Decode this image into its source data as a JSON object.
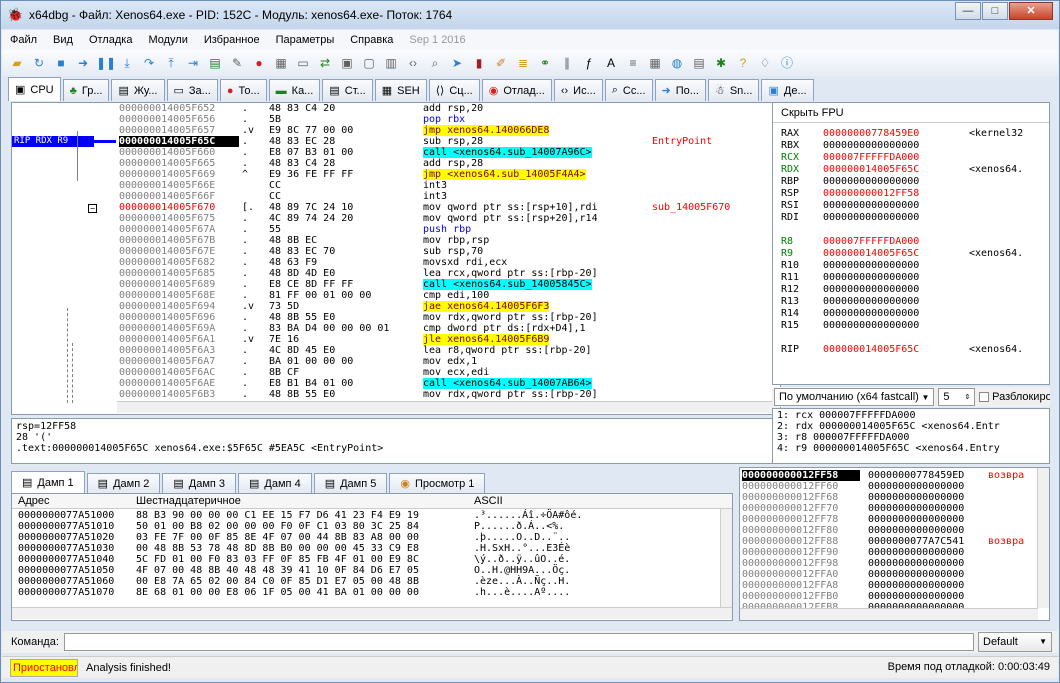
{
  "window": {
    "title": "x64dbg - Файл: Xenos64.exe - PID: 152C - Модуль: xenos64.exe- Поток: 1764",
    "app_icon": "bug-icon"
  },
  "menu": {
    "items": [
      "Файл",
      "Вид",
      "Отладка",
      "Модули",
      "Избранное",
      "Параметры",
      "Справка"
    ],
    "date": "Sep 1 2016"
  },
  "tabs": [
    {
      "label": "CPU",
      "icon": "cpu-icon"
    },
    {
      "label": "Гр...",
      "icon": "graph-icon"
    },
    {
      "label": "Жу...",
      "icon": "log-icon"
    },
    {
      "label": "За...",
      "icon": "notes-icon"
    },
    {
      "label": "То...",
      "icon": "breakpoint-icon"
    },
    {
      "label": "Ка...",
      "icon": "memory-icon"
    },
    {
      "label": "Ст...",
      "icon": "stack-icon"
    },
    {
      "label": "SEH",
      "icon": "seh-icon"
    },
    {
      "label": "Сц...",
      "icon": "script-icon"
    },
    {
      "label": "Отлад...",
      "icon": "symbols-icon"
    },
    {
      "label": "Ис...",
      "icon": "source-icon"
    },
    {
      "label": "Сс...",
      "icon": "references-icon"
    },
    {
      "label": "По...",
      "icon": "threads-icon"
    },
    {
      "label": "Sn...",
      "icon": "snowman-icon"
    },
    {
      "label": "Де...",
      "icon": "handles-icon"
    }
  ],
  "disasm": {
    "rip_label": "RIP RDX R9",
    "rows": [
      {
        "addr": "000000014005F652",
        "mark": ".",
        "bytes": "48 83 C4 20",
        "ins": "add rsp,20",
        "cmt": "",
        "type": "plain"
      },
      {
        "addr": "000000014005F656",
        "mark": ".",
        "bytes": "5B",
        "ins": "pop rbx",
        "cmt": "",
        "type": "push"
      },
      {
        "addr": "000000014005F657",
        "mark": ".v",
        "bytes": "E9 8C 77 00 00",
        "ins": "jmp xenos64.140066DE8",
        "cmt": "",
        "type": "jmp"
      },
      {
        "addr": "000000014005F65C",
        "mark": ".",
        "bytes": "48 83 EC 28",
        "ins": "sub rsp,28",
        "cmt": "EntryPoint",
        "type": "plain",
        "current": true
      },
      {
        "addr": "000000014005F660",
        "mark": ".",
        "bytes": "E8 07 B3 01 00",
        "ins": "call <xenos64.sub_14007A96C>",
        "cmt": "",
        "type": "call"
      },
      {
        "addr": "000000014005F665",
        "mark": ".",
        "bytes": "48 83 C4 28",
        "ins": "add rsp,28",
        "cmt": "",
        "type": "plain"
      },
      {
        "addr": "000000014005F669",
        "mark": "^",
        "bytes": "E9 36 FE FF FF",
        "ins": "jmp <xenos64.sub_14005F4A4>",
        "cmt": "",
        "type": "jmp"
      },
      {
        "addr": "000000014005F66E",
        "mark": "",
        "bytes": "CC",
        "ins": "int3",
        "cmt": "",
        "type": "plain"
      },
      {
        "addr": "000000014005F66F",
        "mark": "",
        "bytes": "CC",
        "ins": "int3",
        "cmt": "",
        "type": "plain"
      },
      {
        "addr": "000000014005F670",
        "mark": "[.",
        "bytes": "48 89 7C 24 10",
        "ins": "mov qword ptr ss:[rsp+10],rdi",
        "cmt": "sub_14005F670",
        "type": "plain",
        "red": true
      },
      {
        "addr": "000000014005F675",
        "mark": ".",
        "bytes": "4C 89 74 24 20",
        "ins": "mov qword ptr ss:[rsp+20],r14",
        "cmt": "",
        "type": "plain"
      },
      {
        "addr": "000000014005F67A",
        "mark": ".",
        "bytes": "55",
        "ins": "push rbp",
        "cmt": "",
        "type": "push"
      },
      {
        "addr": "000000014005F67B",
        "mark": ".",
        "bytes": "48 8B EC",
        "ins": "mov rbp,rsp",
        "cmt": "",
        "type": "plain"
      },
      {
        "addr": "000000014005F67E",
        "mark": ".",
        "bytes": "48 83 EC 70",
        "ins": "sub rsp,70",
        "cmt": "",
        "type": "plain"
      },
      {
        "addr": "000000014005F682",
        "mark": ".",
        "bytes": "48 63 F9",
        "ins": "movsxd rdi,ecx",
        "cmt": "",
        "type": "plain"
      },
      {
        "addr": "000000014005F685",
        "mark": ".",
        "bytes": "48 8D 4D E0",
        "ins": "lea rcx,qword ptr ss:[rbp-20]",
        "cmt": "",
        "type": "plain"
      },
      {
        "addr": "000000014005F689",
        "mark": ".",
        "bytes": "E8 CE 8D FF FF",
        "ins": "call <xenos64.sub_14005845C>",
        "cmt": "",
        "type": "call"
      },
      {
        "addr": "000000014005F68E",
        "mark": ".",
        "bytes": "81 FF 00 01 00 00",
        "ins": "cmp edi,100",
        "cmt": "",
        "type": "plain"
      },
      {
        "addr": "000000014005F694",
        "mark": ".v",
        "bytes": "73 5D",
        "ins": "jae xenos64.14005F6F3",
        "cmt": "",
        "type": "jmp"
      },
      {
        "addr": "000000014005F696",
        "mark": ".",
        "bytes": "48 8B 55 E0",
        "ins": "mov rdx,qword ptr ss:[rbp-20]",
        "cmt": "",
        "type": "plain"
      },
      {
        "addr": "000000014005F69A",
        "mark": ".",
        "bytes": "83 BA D4 00 00 00 01",
        "ins": "cmp dword ptr ds:[rdx+D4],1",
        "cmt": "",
        "type": "plain"
      },
      {
        "addr": "000000014005F6A1",
        "mark": ".v",
        "bytes": "7E 16",
        "ins": "jle xenos64.14005F6B9",
        "cmt": "",
        "type": "jmp"
      },
      {
        "addr": "000000014005F6A3",
        "mark": ".",
        "bytes": "4C 8D 45 E0",
        "ins": "lea r8,qword ptr ss:[rbp-20]",
        "cmt": "",
        "type": "plain"
      },
      {
        "addr": "000000014005F6A7",
        "mark": ".",
        "bytes": "BA 01 00 00 00",
        "ins": "mov edx,1",
        "cmt": "",
        "type": "plain"
      },
      {
        "addr": "000000014005F6AC",
        "mark": ".",
        "bytes": "8B CF",
        "ins": "mov ecx,edi",
        "cmt": "",
        "type": "plain"
      },
      {
        "addr": "000000014005F6AE",
        "mark": ".",
        "bytes": "E8 B1 B4 01 00",
        "ins": "call <xenos64.sub_14007AB64>",
        "cmt": "",
        "type": "call"
      },
      {
        "addr": "000000014005F6B3",
        "mark": ".",
        "bytes": "48 8B 55 E0",
        "ins": "mov rdx,qword ptr ss:[rbp-20]",
        "cmt": "",
        "type": "plain"
      }
    ]
  },
  "info": {
    "lines": [
      "rsp=12FF58",
      "28 '('",
      ".text:000000014005F65C xenos64.exe:$5F65C #5EA5C <EntryPoint>"
    ]
  },
  "registers": {
    "header": "Скрыть FPU",
    "rows": [
      {
        "name": "RAX",
        "value": "00000000778459E0",
        "cmt": "<kernel32",
        "changed": false,
        "red": true
      },
      {
        "name": "RBX",
        "value": "0000000000000000",
        "cmt": "",
        "changed": false
      },
      {
        "name": "RCX",
        "value": "000007FFFFFDA000",
        "cmt": "",
        "changed": true
      },
      {
        "name": "RDX",
        "value": "000000014005F65C",
        "cmt": "<xenos64.",
        "changed": true
      },
      {
        "name": "RBP",
        "value": "0000000000000000",
        "cmt": "",
        "changed": false
      },
      {
        "name": "RSP",
        "value": "000000000012FF58",
        "cmt": "",
        "changed": false,
        "red": true
      },
      {
        "name": "RSI",
        "value": "0000000000000000",
        "cmt": "",
        "changed": false
      },
      {
        "name": "RDI",
        "value": "0000000000000000",
        "cmt": "",
        "changed": false
      },
      {
        "name": "",
        "value": "",
        "cmt": "",
        "changed": false
      },
      {
        "name": "R8",
        "value": "000007FFFFFDA000",
        "cmt": "",
        "changed": true
      },
      {
        "name": "R9",
        "value": "000000014005F65C",
        "cmt": "<xenos64.",
        "changed": true
      },
      {
        "name": "R10",
        "value": "0000000000000000",
        "cmt": "",
        "changed": false
      },
      {
        "name": "R11",
        "value": "0000000000000000",
        "cmt": "",
        "changed": false
      },
      {
        "name": "R12",
        "value": "0000000000000000",
        "cmt": "",
        "changed": false
      },
      {
        "name": "R13",
        "value": "0000000000000000",
        "cmt": "",
        "changed": false
      },
      {
        "name": "R14",
        "value": "0000000000000000",
        "cmt": "",
        "changed": false
      },
      {
        "name": "R15",
        "value": "0000000000000000",
        "cmt": "",
        "changed": false
      },
      {
        "name": "",
        "value": "",
        "cmt": "",
        "changed": false
      },
      {
        "name": "RIP",
        "value": "000000014005F65C",
        "cmt": "<xenos64.",
        "changed": false,
        "red": true
      }
    ]
  },
  "callconv": {
    "selected": "По умолчанию (x64 fastcall)",
    "count": "5",
    "unlock_label": "Разблокировать"
  },
  "args": [
    "1: rcx 000007FFFFFDA000",
    "2: rdx 000000014005F65C <xenos64.Entr",
    "3: r8 000007FFFFFDA000",
    "4: r9 000000014005F65C <xenos64.Entry"
  ],
  "dump_tabs": [
    "Дамп 1",
    "Дамп 2",
    "Дамп 3",
    "Дамп 4",
    "Дамп 5",
    "Просмотр 1"
  ],
  "dump": {
    "col_addr": "Адрес",
    "col_hex": "Шестнадцатеричное",
    "col_ascii": "ASCII",
    "rows": [
      {
        "addr": "0000000077A51000",
        "hex": "88 B3 90 00 00 00 C1 EE 15 F7 D6 41 23 F4 E9 19",
        "ascii": ".³......Áî.÷ÖA#ôé."
      },
      {
        "addr": "0000000077A51010",
        "hex": "50 01 00 B8 02 00 00 00 F0 0F C1 03 80 3C 25 84",
        "ascii": "P......ð.Á..<%."
      },
      {
        "addr": "0000000077A51020",
        "hex": "03 FE 7F 00 0F 85 8E 4F 07 00 44 8B 83 A8 00 00",
        "ascii": ".þ.....O..D..¨.."
      },
      {
        "addr": "0000000077A51030",
        "hex": "00 48 8B 53 78 48 8D 8B B0 00 00 00 45 33 C9 E8",
        "ascii": ".H.SxH..°...E3Éè"
      },
      {
        "addr": "0000000077A51040",
        "hex": "5C FD 01 00 F0 83 03 FF 0F 85 FB 4F 01 00 E9 8C",
        "ascii": "\\ý..ð..ÿ..ûO..é."
      },
      {
        "addr": "0000000077A51050",
        "hex": "4F 07 00 48 8B 40 48 48 39 41 10 0F 84 D6 E7 05",
        "ascii": "O..H.@HH9A...Öç."
      },
      {
        "addr": "0000000077A51060",
        "hex": "00 E8 7A 65 02 00 84 C0 0F 85 D1 E7 05 00 48 8B",
        "ascii": ".èze...À..Ñç..H."
      },
      {
        "addr": "0000000077A51070",
        "hex": "8E 68 01 00 00 E8 06 1F 05 00 41 BA 01 00 00 00",
        "ascii": ".h...è....Aº...."
      }
    ]
  },
  "stack": {
    "rows": [
      {
        "addr": "000000000012FF58",
        "val": "00000000778459ED",
        "cmt": "возвра",
        "current": true
      },
      {
        "addr": "000000000012FF60",
        "val": "0000000000000000",
        "cmt": ""
      },
      {
        "addr": "000000000012FF68",
        "val": "0000000000000000",
        "cmt": ""
      },
      {
        "addr": "000000000012FF70",
        "val": "0000000000000000",
        "cmt": ""
      },
      {
        "addr": "000000000012FF78",
        "val": "0000000000000000",
        "cmt": ""
      },
      {
        "addr": "000000000012FF80",
        "val": "0000000000000000",
        "cmt": ""
      },
      {
        "addr": "000000000012FF88",
        "val": "0000000077A7C541",
        "cmt": "возвра"
      },
      {
        "addr": "000000000012FF90",
        "val": "0000000000000000",
        "cmt": ""
      },
      {
        "addr": "000000000012FF98",
        "val": "0000000000000000",
        "cmt": ""
      },
      {
        "addr": "000000000012FFA0",
        "val": "0000000000000000",
        "cmt": ""
      },
      {
        "addr": "000000000012FFA8",
        "val": "0000000000000000",
        "cmt": ""
      },
      {
        "addr": "000000000012FFB0",
        "val": "0000000000000000",
        "cmt": ""
      },
      {
        "addr": "000000000012FFB8",
        "val": "0000000000000000",
        "cmt": ""
      }
    ]
  },
  "command": {
    "label": "Команда:",
    "value": "",
    "mode": "Default"
  },
  "status": {
    "state": "Приостановлено",
    "message": "Analysis finished!",
    "time": "Время под отладкой: 0:00:03:49"
  },
  "colors": {
    "current_addr_bg": "#000000",
    "jmp_bg": "#ffff00",
    "call_bg": "#00ffff",
    "rip_label_bg": "#0000ff",
    "changed_register": "#ff0000",
    "paused_bg": "#ffff00"
  }
}
